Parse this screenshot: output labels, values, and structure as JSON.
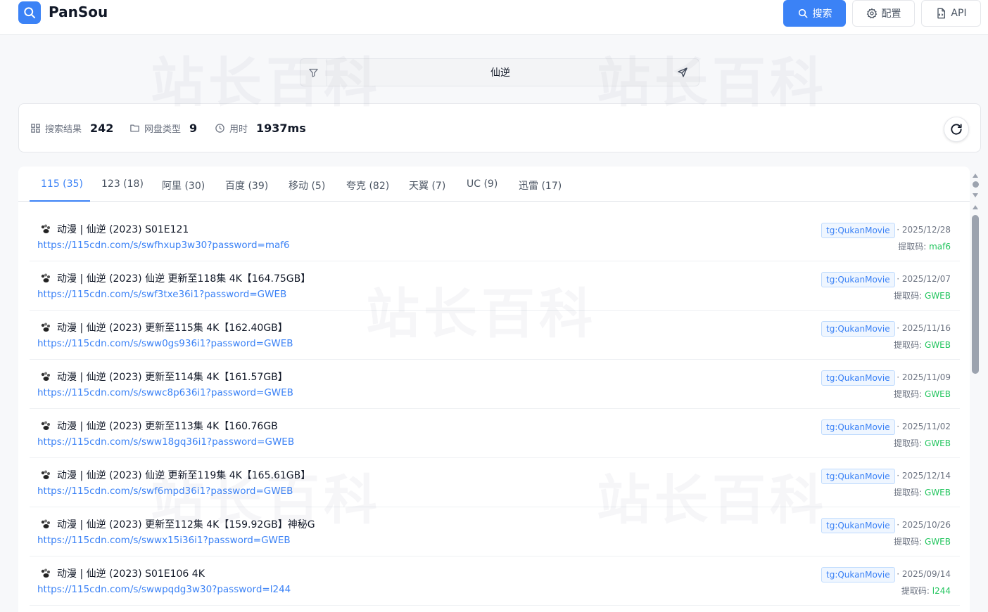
{
  "app": {
    "brand": "PanSou",
    "search_button": "搜索",
    "config_button": "配置",
    "api_button": "API"
  },
  "search": {
    "query": "仙逆"
  },
  "stats": {
    "results_label": "搜索结果",
    "results_value": "242",
    "types_label": "网盘类型",
    "types_value": "9",
    "time_label": "用时",
    "time_value": "1937ms"
  },
  "watermark": "站长百科",
  "tabs": [
    {
      "label": "115 (35)",
      "active": true
    },
    {
      "label": "123 (18)"
    },
    {
      "label": "阿里 (30)"
    },
    {
      "label": "百度 (39)"
    },
    {
      "label": "移动 (5)"
    },
    {
      "label": "夸克 (82)"
    },
    {
      "label": "天翼 (7)"
    },
    {
      "label": "UC (9)"
    },
    {
      "label": "迅雷 (17)"
    }
  ],
  "code_label": "提取码: ",
  "results": [
    {
      "title": "动漫 | 仙逆 (2023) S01E121",
      "url": "https://115cdn.com/s/swfhxup3w30?password=maf6",
      "source": "tg:QukanMovie",
      "date": "· 2025/12/28",
      "code": "maf6"
    },
    {
      "title": "动漫 | 仙逆 (2023) 仙逆 更新至118集 4K【164.75GB】",
      "url": "https://115cdn.com/s/swf3txe36i1?password=GWEB",
      "source": "tg:QukanMovie",
      "date": "· 2025/12/07",
      "code": "GWEB"
    },
    {
      "title": "动漫 | 仙逆 (2023) 更新至115集 4K【162.40GB】",
      "url": "https://115cdn.com/s/sww0gs936i1?password=GWEB",
      "source": "tg:QukanMovie",
      "date": "· 2025/11/16",
      "code": "GWEB"
    },
    {
      "title": "动漫 | 仙逆 (2023) 更新至114集 4K【161.57GB】",
      "url": "https://115cdn.com/s/swwc8p636i1?password=GWEB",
      "source": "tg:QukanMovie",
      "date": "· 2025/11/09",
      "code": "GWEB"
    },
    {
      "title": "动漫 | 仙逆 (2023) 更新至113集 4K【160.76GB",
      "url": "https://115cdn.com/s/sww18gq36i1?password=GWEB",
      "source": "tg:QukanMovie",
      "date": "· 2025/11/02",
      "code": "GWEB"
    },
    {
      "title": "动漫 | 仙逆 (2023) 仙逆 更新至119集 4K【165.61GB】",
      "url": "https://115cdn.com/s/swf6mpd36i1?password=GWEB",
      "source": "tg:QukanMovie",
      "date": "· 2025/12/14",
      "code": "GWEB"
    },
    {
      "title": "动漫 | 仙逆 (2023) 更新至112集 4K【159.92GB】神秘G",
      "url": "https://115cdn.com/s/swwx15i36i1?password=GWEB",
      "source": "tg:QukanMovie",
      "date": "· 2025/10/26",
      "code": "GWEB"
    },
    {
      "title": "动漫 | 仙逆 (2023) S01E106 4K",
      "url": "https://115cdn.com/s/swwpqdg3w30?password=l244",
      "source": "tg:QukanMovie",
      "date": "· 2025/09/14",
      "code": "l244"
    }
  ],
  "colors": {
    "accent": "#3b82f6",
    "code": "#22c55e",
    "tag_bg": "#eff6ff"
  }
}
